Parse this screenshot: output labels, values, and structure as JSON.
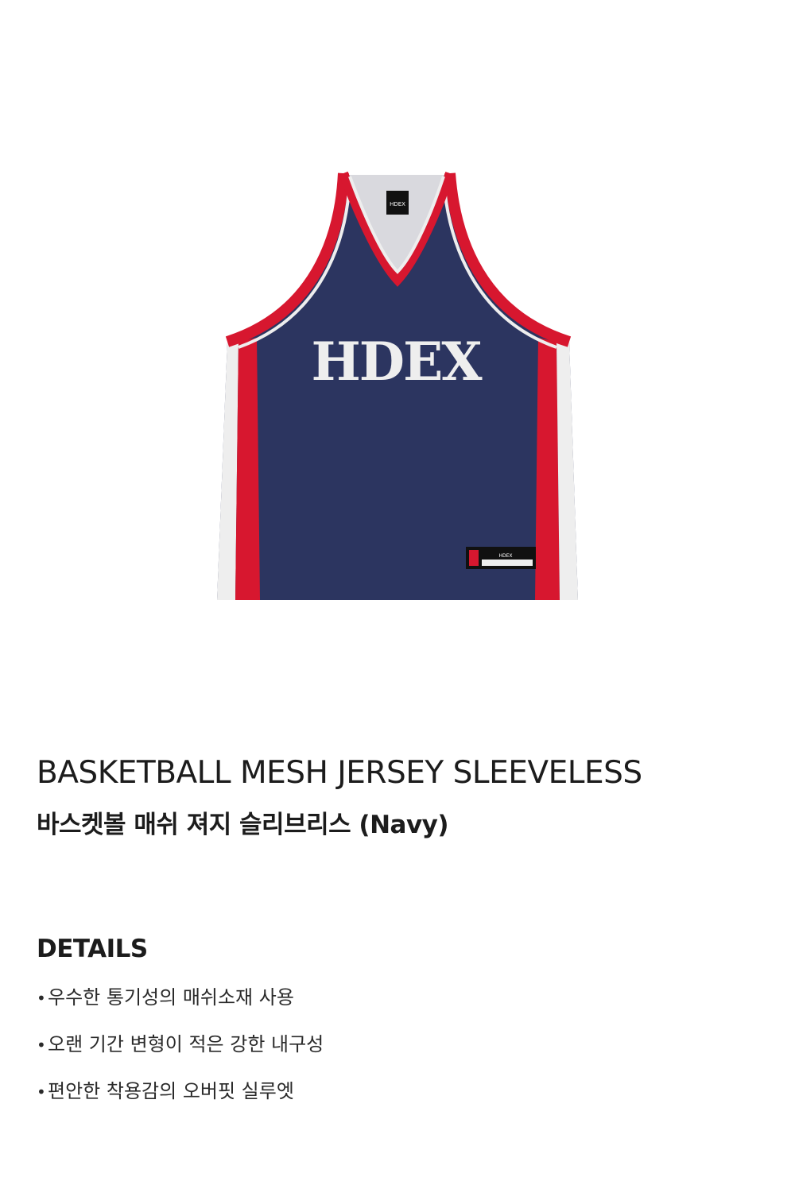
{
  "product": {
    "image_alt": "HDEX basketball mesh jersey sleeveless navy",
    "jersey_text": "HDEX",
    "neck_tag_text": "HDEX",
    "hem_tag_text": "HDEX",
    "colors": {
      "body": "#2c3560",
      "red": "#d7172f",
      "white": "#eeeeee",
      "mesh": "#d9d9de"
    },
    "title_en": "BASKETBALL MESH JERSEY SLEEVELESS",
    "title_ko": "바스켓볼 매쉬 져지 슬리브리스 (Navy)"
  },
  "details": {
    "heading": "DETAILS",
    "bullet": "•",
    "items": [
      {
        "text": "우수한 통기성의 매쉬소재 사용"
      },
      {
        "text": "오랜 기간 변형이 적은 강한 내구성"
      },
      {
        "text": "편안한 착용감의 오버핏 실루엣"
      }
    ]
  }
}
